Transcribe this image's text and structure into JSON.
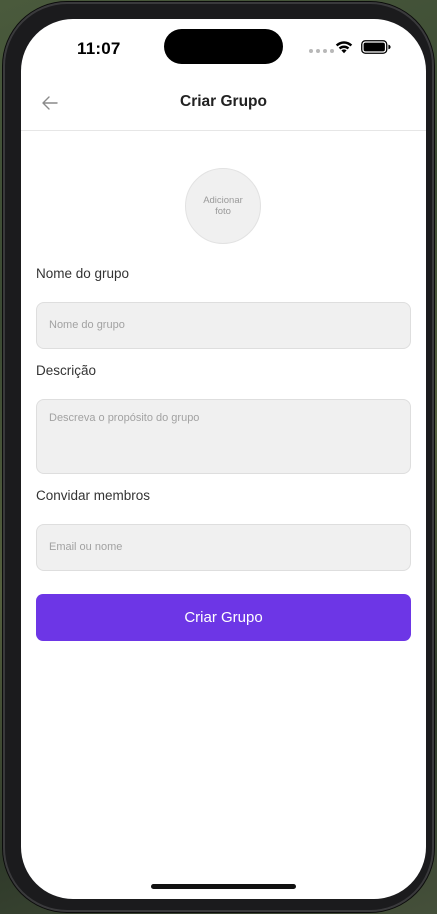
{
  "status_bar": {
    "time": "11:07",
    "wifi_icon": "wifi-icon",
    "battery_icon": "battery-icon"
  },
  "header": {
    "back_icon": "arrow-left-icon",
    "title": "Criar Grupo"
  },
  "photo": {
    "label": "Adicionar foto"
  },
  "form": {
    "name": {
      "label": "Nome do grupo",
      "placeholder": "Nome do grupo",
      "value": ""
    },
    "description": {
      "label": "Descrição",
      "placeholder": "Descreva o propósito do grupo",
      "value": ""
    },
    "invite": {
      "label": "Convidar membros",
      "placeholder": "Email ou nome",
      "value": ""
    },
    "submit_label": "Criar Grupo"
  },
  "colors": {
    "accent": "#6d36e6",
    "input_background": "#f0f0f0"
  }
}
